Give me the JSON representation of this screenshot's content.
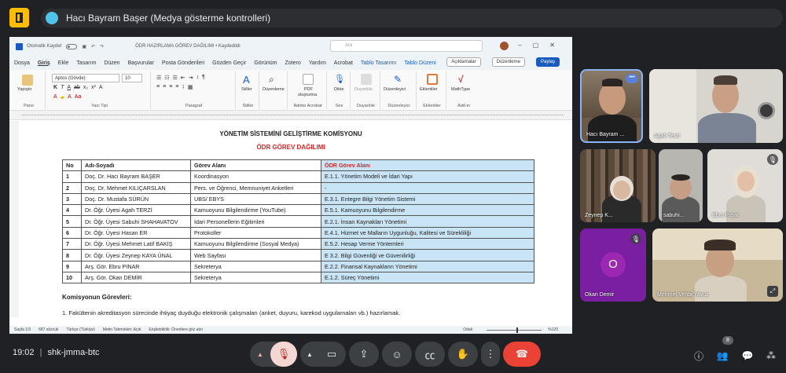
{
  "meeting": {
    "presenter_banner": "Hacı Bayram Başer (Medya gösterme kontrolleri)",
    "time": "19:02",
    "meeting_code": "shk-jmma-btc",
    "participant_count": "8"
  },
  "word": {
    "autosave_label": "Otomatik Kaydet",
    "doc_name": "ÖDR HAZIRLAMA GÖREV DAĞILIMI • Kaydedildi",
    "search_placeholder": "Ara",
    "menu": [
      "Dosya",
      "Giriş",
      "Ekle",
      "Tasarım",
      "Düzen",
      "Başvurular",
      "Posta Gönderileri",
      "Gözden Geçir",
      "Görünüm",
      "Zotero",
      "Yardım",
      "Acrobat",
      "Tablo Tasarımı",
      "Tablo Düzeni"
    ],
    "comments_btn": "Açıklamalar",
    "editing_btn": "Düzenleme",
    "share_btn": "Paylaş",
    "font_name": "Aptos (Gövde)",
    "font_size": "10",
    "ribbon": {
      "paste": "Yapıştır",
      "pano": "Pano",
      "yazi_tipi": "Yazı Tipi",
      "paragraf": "Paragraf",
      "stiller": "Stiller",
      "stiller_group": "Stiller",
      "duzenleme": "Düzenleme",
      "pdf": "PDF",
      "pdf2": "oluşturma",
      "acrobat": "Adobe Acrobat",
      "dikte": "Dikte",
      "ses": "Ses",
      "duyarlilik": "Duyarlılık",
      "duyarlilik_group": "Duyarlılık",
      "duzenleyici": "Düzenleyici",
      "duzenleyici_group": "Düzenleyici",
      "eklentiler": "Eklentiler",
      "eklentiler_group": "Eklentiler",
      "mathtype": "MathType",
      "addin": "Add-in"
    },
    "doc": {
      "title1": "YÖNETİM SİSTEMİNİ GELİŞTİRME KOMİSYONU",
      "title2": "ÖDR GÖREV DAĞILIMI",
      "headers": [
        "No",
        "Adı-Soyadı",
        "Görev Alanı",
        "ÖDR Görev Alanı"
      ],
      "rows": [
        [
          "1",
          "Doç. Dr. Hacı Bayram BAŞER",
          "Koordinasyon",
          "E.1.1. Yönetim Modeli ve İdari Yapı"
        ],
        [
          "2",
          "Doç. Dr. Mehmet KILIÇARSLAN",
          "Pers. ve Öğrenci, Memnuniyet Anketleri",
          "-"
        ],
        [
          "3",
          "Doç. Dr. Mustafa SÜRÜN",
          "UBS/ EBYS",
          "E.3.1. Entegre Bilgi Yönetim Sistemi"
        ],
        [
          "4",
          "Dr. Öğr. Üyesi Agah TERZİ",
          "Kamuoyunu Bilgilendirme (YouTube)",
          "E.5.1. Kamuoyunu Bilgilendirme"
        ],
        [
          "5",
          "Dr. Öğr. Üyesi Sabuhi SHAHAVATOV",
          "İdari Personellerin Eğitimleri",
          "E.2.1. İnsan Kaynakları Yönetimi"
        ],
        [
          "6",
          "Dr. Öğr. Üyesi Hasan ER",
          "Protokoller",
          "E.4.1. Hizmet ve Malların Uygunluğu, Kalitesi ve Sürekliliği"
        ],
        [
          "7",
          "Dr. Öğr. Üyesi Mehmet Latif BAKIŞ",
          "Kamuoyunu Bilgilendirme (Sosyal Medya)",
          "E.5.2. Hesap Verme Yöntemleri"
        ],
        [
          "8",
          "Dr. Öğr. Üyesi Zeynep KAYA ÜNAL",
          "Web Sayfası",
          "E 3.2. Bilgi Güvenliği ve Güvenilirliği"
        ],
        [
          "9",
          "Arş. Gör. Ebru PINAR",
          "Sekreterya",
          "E.2.2. Finansal Kaynakların Yönetimi"
        ],
        [
          "10",
          "Arş. Gör. Okan DEMİR",
          "Sekreterya",
          "E.1.2. Süreç Yönetimi"
        ]
      ],
      "section_title": "Komisyonun Görevleri:",
      "section_item1": "1. Fakültenin akreditasyon sürecinde ihtiyaç duyduğu elektronik çalışmaları (anket, duyuru, karekod uygulamaları vb.) hazırlamak."
    },
    "status": {
      "page": "Sayfa 1/3",
      "words": "687 sözcük",
      "lang": "Türkçe (Türkiye)",
      "predict": "Metin Tahminleri: Açık",
      "access": "Erişilebilirlik: Önerilere göz atın",
      "focus": "Odak",
      "zoom": "%120"
    }
  },
  "participants": [
    {
      "name": "Hacı Bayram ..."
    },
    {
      "name": "Agah Terzi"
    },
    {
      "name": "Zeynep K..."
    },
    {
      "name": "sabuhi..."
    },
    {
      "name": "Ebru Pınar"
    },
    {
      "name": "Okan Demir",
      "initial": "O"
    },
    {
      "name": "Mehmet Vehbi Yavuz"
    }
  ],
  "colors": {
    "meet_bg": "#202124",
    "end_call": "#ea4335",
    "table_highlight": "#c9e4f5",
    "title_red": "#e02020",
    "okan_tile": "#7b1fa2"
  }
}
